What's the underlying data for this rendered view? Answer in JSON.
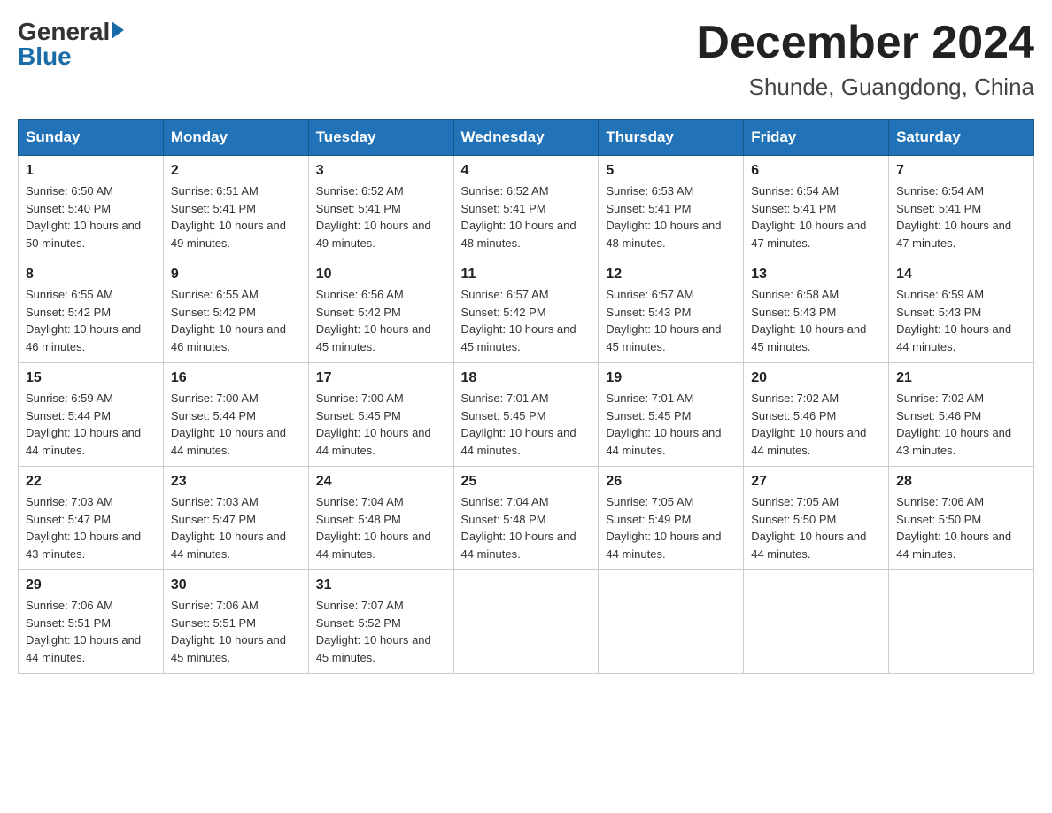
{
  "logo": {
    "general": "General",
    "blue": "Blue"
  },
  "title": "December 2024",
  "subtitle": "Shunde, Guangdong, China",
  "weekdays": [
    "Sunday",
    "Monday",
    "Tuesday",
    "Wednesday",
    "Thursday",
    "Friday",
    "Saturday"
  ],
  "weeks": [
    [
      {
        "day": "1",
        "sunrise": "Sunrise: 6:50 AM",
        "sunset": "Sunset: 5:40 PM",
        "daylight": "Daylight: 10 hours and 50 minutes."
      },
      {
        "day": "2",
        "sunrise": "Sunrise: 6:51 AM",
        "sunset": "Sunset: 5:41 PM",
        "daylight": "Daylight: 10 hours and 49 minutes."
      },
      {
        "day": "3",
        "sunrise": "Sunrise: 6:52 AM",
        "sunset": "Sunset: 5:41 PM",
        "daylight": "Daylight: 10 hours and 49 minutes."
      },
      {
        "day": "4",
        "sunrise": "Sunrise: 6:52 AM",
        "sunset": "Sunset: 5:41 PM",
        "daylight": "Daylight: 10 hours and 48 minutes."
      },
      {
        "day": "5",
        "sunrise": "Sunrise: 6:53 AM",
        "sunset": "Sunset: 5:41 PM",
        "daylight": "Daylight: 10 hours and 48 minutes."
      },
      {
        "day": "6",
        "sunrise": "Sunrise: 6:54 AM",
        "sunset": "Sunset: 5:41 PM",
        "daylight": "Daylight: 10 hours and 47 minutes."
      },
      {
        "day": "7",
        "sunrise": "Sunrise: 6:54 AM",
        "sunset": "Sunset: 5:41 PM",
        "daylight": "Daylight: 10 hours and 47 minutes."
      }
    ],
    [
      {
        "day": "8",
        "sunrise": "Sunrise: 6:55 AM",
        "sunset": "Sunset: 5:42 PM",
        "daylight": "Daylight: 10 hours and 46 minutes."
      },
      {
        "day": "9",
        "sunrise": "Sunrise: 6:55 AM",
        "sunset": "Sunset: 5:42 PM",
        "daylight": "Daylight: 10 hours and 46 minutes."
      },
      {
        "day": "10",
        "sunrise": "Sunrise: 6:56 AM",
        "sunset": "Sunset: 5:42 PM",
        "daylight": "Daylight: 10 hours and 45 minutes."
      },
      {
        "day": "11",
        "sunrise": "Sunrise: 6:57 AM",
        "sunset": "Sunset: 5:42 PM",
        "daylight": "Daylight: 10 hours and 45 minutes."
      },
      {
        "day": "12",
        "sunrise": "Sunrise: 6:57 AM",
        "sunset": "Sunset: 5:43 PM",
        "daylight": "Daylight: 10 hours and 45 minutes."
      },
      {
        "day": "13",
        "sunrise": "Sunrise: 6:58 AM",
        "sunset": "Sunset: 5:43 PM",
        "daylight": "Daylight: 10 hours and 45 minutes."
      },
      {
        "day": "14",
        "sunrise": "Sunrise: 6:59 AM",
        "sunset": "Sunset: 5:43 PM",
        "daylight": "Daylight: 10 hours and 44 minutes."
      }
    ],
    [
      {
        "day": "15",
        "sunrise": "Sunrise: 6:59 AM",
        "sunset": "Sunset: 5:44 PM",
        "daylight": "Daylight: 10 hours and 44 minutes."
      },
      {
        "day": "16",
        "sunrise": "Sunrise: 7:00 AM",
        "sunset": "Sunset: 5:44 PM",
        "daylight": "Daylight: 10 hours and 44 minutes."
      },
      {
        "day": "17",
        "sunrise": "Sunrise: 7:00 AM",
        "sunset": "Sunset: 5:45 PM",
        "daylight": "Daylight: 10 hours and 44 minutes."
      },
      {
        "day": "18",
        "sunrise": "Sunrise: 7:01 AM",
        "sunset": "Sunset: 5:45 PM",
        "daylight": "Daylight: 10 hours and 44 minutes."
      },
      {
        "day": "19",
        "sunrise": "Sunrise: 7:01 AM",
        "sunset": "Sunset: 5:45 PM",
        "daylight": "Daylight: 10 hours and 44 minutes."
      },
      {
        "day": "20",
        "sunrise": "Sunrise: 7:02 AM",
        "sunset": "Sunset: 5:46 PM",
        "daylight": "Daylight: 10 hours and 44 minutes."
      },
      {
        "day": "21",
        "sunrise": "Sunrise: 7:02 AM",
        "sunset": "Sunset: 5:46 PM",
        "daylight": "Daylight: 10 hours and 43 minutes."
      }
    ],
    [
      {
        "day": "22",
        "sunrise": "Sunrise: 7:03 AM",
        "sunset": "Sunset: 5:47 PM",
        "daylight": "Daylight: 10 hours and 43 minutes."
      },
      {
        "day": "23",
        "sunrise": "Sunrise: 7:03 AM",
        "sunset": "Sunset: 5:47 PM",
        "daylight": "Daylight: 10 hours and 44 minutes."
      },
      {
        "day": "24",
        "sunrise": "Sunrise: 7:04 AM",
        "sunset": "Sunset: 5:48 PM",
        "daylight": "Daylight: 10 hours and 44 minutes."
      },
      {
        "day": "25",
        "sunrise": "Sunrise: 7:04 AM",
        "sunset": "Sunset: 5:48 PM",
        "daylight": "Daylight: 10 hours and 44 minutes."
      },
      {
        "day": "26",
        "sunrise": "Sunrise: 7:05 AM",
        "sunset": "Sunset: 5:49 PM",
        "daylight": "Daylight: 10 hours and 44 minutes."
      },
      {
        "day": "27",
        "sunrise": "Sunrise: 7:05 AM",
        "sunset": "Sunset: 5:50 PM",
        "daylight": "Daylight: 10 hours and 44 minutes."
      },
      {
        "day": "28",
        "sunrise": "Sunrise: 7:06 AM",
        "sunset": "Sunset: 5:50 PM",
        "daylight": "Daylight: 10 hours and 44 minutes."
      }
    ],
    [
      {
        "day": "29",
        "sunrise": "Sunrise: 7:06 AM",
        "sunset": "Sunset: 5:51 PM",
        "daylight": "Daylight: 10 hours and 44 minutes."
      },
      {
        "day": "30",
        "sunrise": "Sunrise: 7:06 AM",
        "sunset": "Sunset: 5:51 PM",
        "daylight": "Daylight: 10 hours and 45 minutes."
      },
      {
        "day": "31",
        "sunrise": "Sunrise: 7:07 AM",
        "sunset": "Sunset: 5:52 PM",
        "daylight": "Daylight: 10 hours and 45 minutes."
      },
      null,
      null,
      null,
      null
    ]
  ]
}
